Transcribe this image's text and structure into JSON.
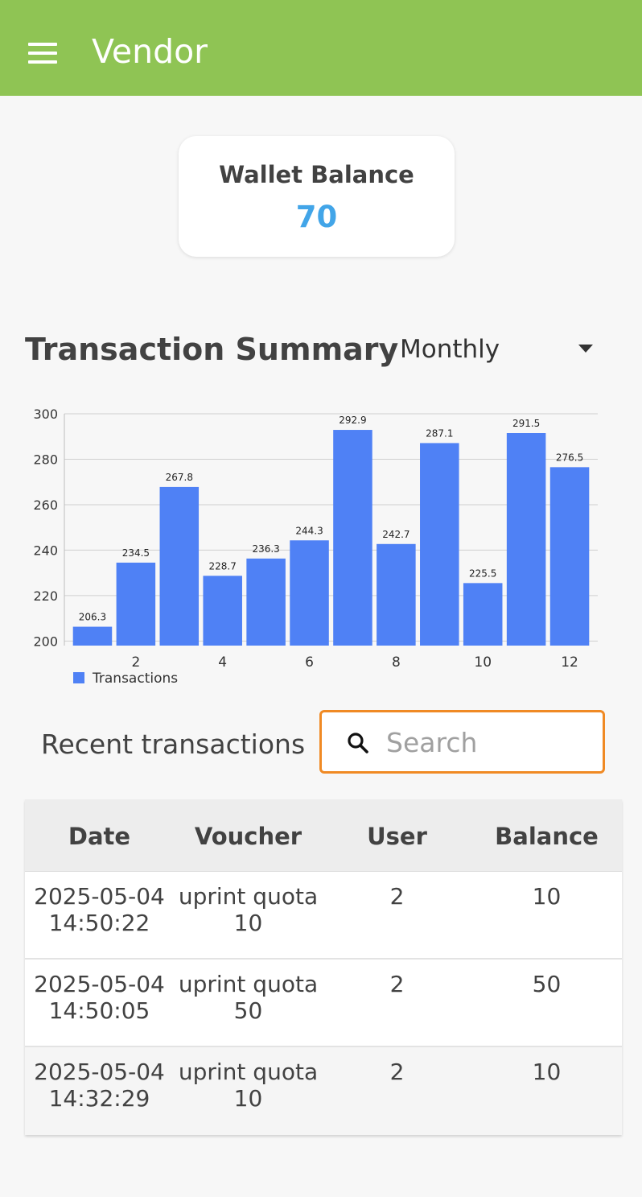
{
  "appbar": {
    "title": "Vendor"
  },
  "wallet": {
    "label": "Wallet Balance",
    "amount": "70"
  },
  "summary": {
    "title": "Transaction Summary",
    "period": "Monthly"
  },
  "chart_data": {
    "type": "bar",
    "categories": [
      1,
      2,
      3,
      4,
      5,
      6,
      7,
      8,
      9,
      10,
      11,
      12
    ],
    "series": [
      {
        "name": "Transactions",
        "values": [
          206.3,
          234.5,
          267.8,
          228.7,
          236.3,
          244.3,
          292.9,
          242.7,
          287.1,
          225.5,
          291.5,
          276.5
        ]
      }
    ],
    "ylim": [
      198,
      300
    ],
    "yticks": [
      200,
      220,
      240,
      260,
      280,
      300
    ],
    "xticks": [
      2,
      4,
      6,
      8,
      10,
      12
    ],
    "grid": true,
    "legend": "bottom-left",
    "color": "#4f81f5"
  },
  "recent": {
    "title": "Recent transactions",
    "search_placeholder": "Search",
    "columns": [
      "Date",
      "Voucher",
      "User",
      "Balance"
    ],
    "rows": [
      {
        "date": "2025-05-04",
        "time": "14:50:22",
        "voucher1": "uprint quota",
        "voucher2": "10",
        "user": "2",
        "balance": "10"
      },
      {
        "date": "2025-05-04",
        "time": "14:50:05",
        "voucher1": "uprint quota",
        "voucher2": "50",
        "user": "2",
        "balance": "50"
      },
      {
        "date": "2025-05-04",
        "time": "14:32:29",
        "voucher1": "uprint quota",
        "voucher2": "10",
        "user": "2",
        "balance": "10"
      }
    ]
  }
}
